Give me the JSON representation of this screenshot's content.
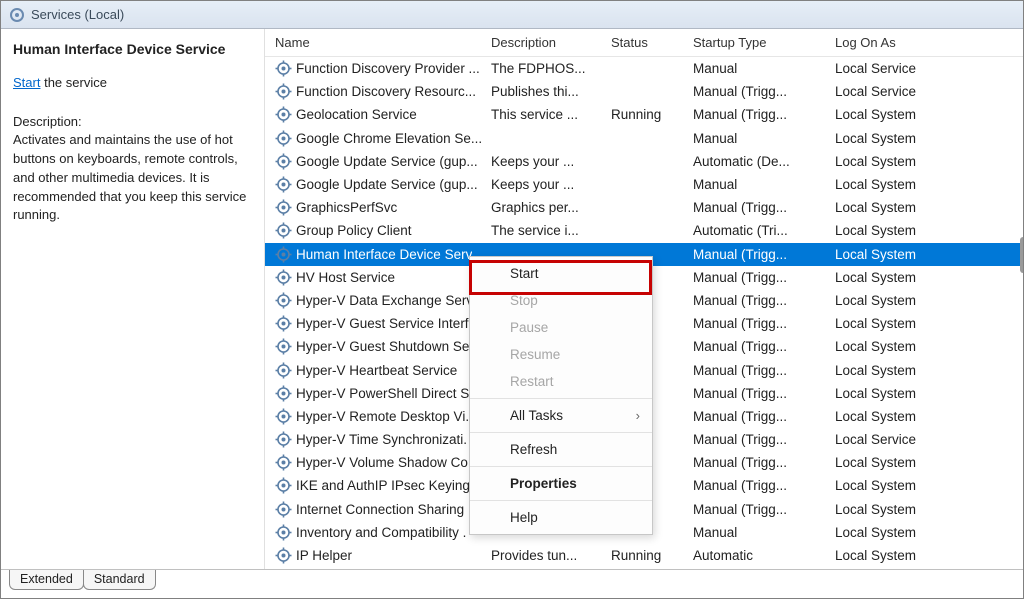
{
  "header": {
    "title": "Services (Local)"
  },
  "detail": {
    "service_name": "Human Interface Device Service",
    "start_link": "Start",
    "start_suffix": " the service",
    "desc_label": "Description:",
    "description": "Activates and maintains the use of hot buttons on keyboards, remote controls, and other multimedia devices. It is recommended that you keep this service running."
  },
  "columns": {
    "name": "Name",
    "description": "Description",
    "status": "Status",
    "startup": "Startup Type",
    "logon": "Log On As"
  },
  "rows": [
    {
      "name": "Function Discovery Provider ...",
      "desc": "The FDPHOS...",
      "status": "",
      "type": "Manual",
      "logon": "Local Service"
    },
    {
      "name": "Function Discovery Resourc...",
      "desc": "Publishes thi...",
      "status": "",
      "type": "Manual (Trigg...",
      "logon": "Local Service"
    },
    {
      "name": "Geolocation Service",
      "desc": "This service ...",
      "status": "Running",
      "type": "Manual (Trigg...",
      "logon": "Local System"
    },
    {
      "name": "Google Chrome Elevation Se...",
      "desc": "",
      "status": "",
      "type": "Manual",
      "logon": "Local System"
    },
    {
      "name": "Google Update Service (gup...",
      "desc": "Keeps your ...",
      "status": "",
      "type": "Automatic (De...",
      "logon": "Local System"
    },
    {
      "name": "Google Update Service (gup...",
      "desc": "Keeps your ...",
      "status": "",
      "type": "Manual",
      "logon": "Local System"
    },
    {
      "name": "GraphicsPerfSvc",
      "desc": "Graphics per...",
      "status": "",
      "type": "Manual (Trigg...",
      "logon": "Local System"
    },
    {
      "name": "Group Policy Client",
      "desc": "The service i...",
      "status": "",
      "type": "Automatic (Tri...",
      "logon": "Local System"
    },
    {
      "name": "Human Interface Device Serv",
      "desc": "",
      "status": "",
      "type": "Manual (Trigg...",
      "logon": "Local System",
      "selected": true
    },
    {
      "name": "HV Host Service",
      "desc": "",
      "status": "",
      "type": "Manual (Trigg...",
      "logon": "Local System"
    },
    {
      "name": "Hyper-V Data Exchange Serv",
      "desc": "",
      "status": "",
      "type": "Manual (Trigg...",
      "logon": "Local System"
    },
    {
      "name": "Hyper-V Guest Service Interf",
      "desc": "",
      "status": "",
      "type": "Manual (Trigg...",
      "logon": "Local System"
    },
    {
      "name": "Hyper-V Guest Shutdown Se",
      "desc": "",
      "status": "",
      "type": "Manual (Trigg...",
      "logon": "Local System"
    },
    {
      "name": "Hyper-V Heartbeat Service",
      "desc": "",
      "status": "",
      "type": "Manual (Trigg...",
      "logon": "Local System"
    },
    {
      "name": "Hyper-V PowerShell Direct S.",
      "desc": "",
      "status": "",
      "type": "Manual (Trigg...",
      "logon": "Local System"
    },
    {
      "name": "Hyper-V Remote Desktop Vi.",
      "desc": "",
      "status": "",
      "type": "Manual (Trigg...",
      "logon": "Local System"
    },
    {
      "name": "Hyper-V Time Synchronizati.",
      "desc": "",
      "status": "",
      "type": "Manual (Trigg...",
      "logon": "Local Service"
    },
    {
      "name": "Hyper-V Volume Shadow Co",
      "desc": "",
      "status": "",
      "type": "Manual (Trigg...",
      "logon": "Local System"
    },
    {
      "name": "IKE and AuthIP IPsec Keying .",
      "desc": "",
      "status": "",
      "type": "Manual (Trigg...",
      "logon": "Local System"
    },
    {
      "name": "Internet Connection Sharing",
      "desc": "",
      "status": "",
      "type": "Manual (Trigg...",
      "logon": "Local System"
    },
    {
      "name": "Inventory and Compatibility .",
      "desc": "",
      "status": "",
      "type": "Manual",
      "logon": "Local System"
    },
    {
      "name": "IP Helper",
      "desc": "Provides tun...",
      "status": "Running",
      "type": "Automatic",
      "logon": "Local System"
    }
  ],
  "menu": {
    "start": "Start",
    "stop": "Stop",
    "pause": "Pause",
    "resume": "Resume",
    "restart": "Restart",
    "all_tasks": "All Tasks",
    "refresh": "Refresh",
    "properties": "Properties",
    "help": "Help"
  },
  "tabs": {
    "extended": "Extended",
    "standard": "Standard"
  }
}
